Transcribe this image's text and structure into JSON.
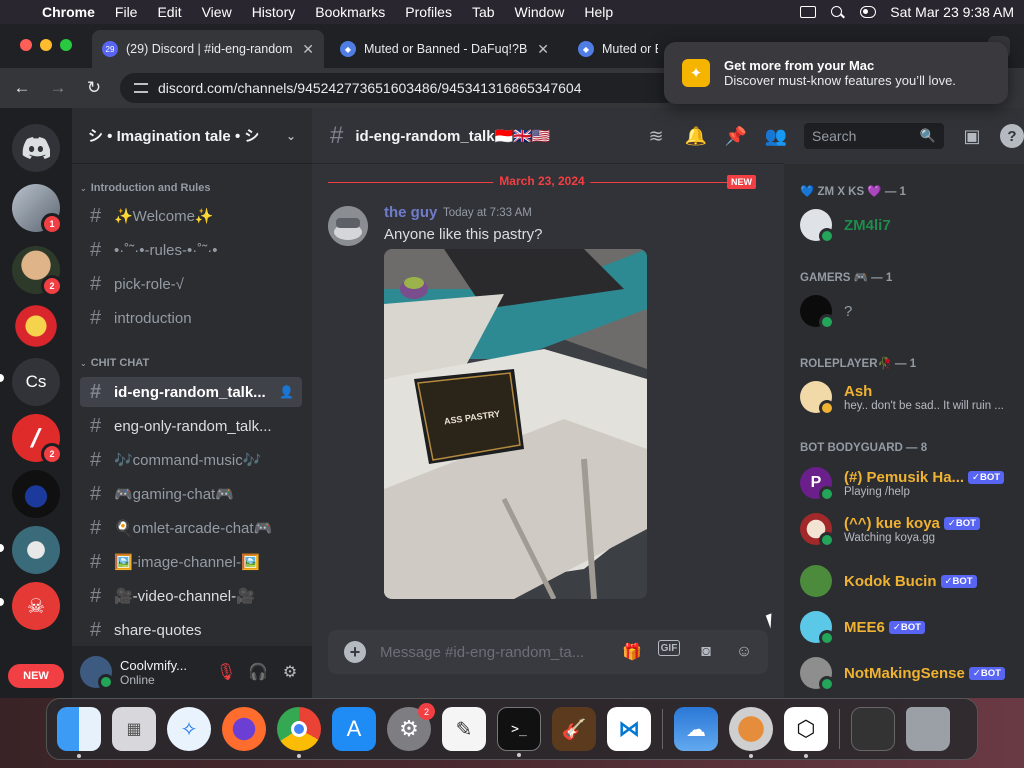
{
  "menubar": {
    "app": "Chrome",
    "items": [
      "File",
      "Edit",
      "View",
      "History",
      "Bookmarks",
      "Profiles",
      "Tab",
      "Window",
      "Help"
    ],
    "clock": "Sat Mar 23  9:38 AM"
  },
  "browser": {
    "tabs": [
      {
        "title": "(29) Discord | #id-eng-random",
        "favicon_badge": "29",
        "active": true
      },
      {
        "title": "Muted or Banned - DaFuq!?B",
        "active": false
      },
      {
        "title": "Muted or Banned - DaFuq!?B",
        "active": false
      }
    ],
    "url": "discord.com/channels/945242773651603486/945341316865347604"
  },
  "notification": {
    "title": "Get more from your Mac",
    "body": "Discover must-know features you’ll love."
  },
  "guilds": {
    "items": [
      {
        "name": "discord-home",
        "badge": null
      },
      {
        "name": "server-1",
        "badge": "1"
      },
      {
        "name": "server-2",
        "badge": "2"
      },
      {
        "name": "server-3",
        "badge": null
      },
      {
        "name": "Cs",
        "label": "Cs",
        "badge": null
      },
      {
        "name": "server-5",
        "badge": "2"
      },
      {
        "name": "server-6",
        "badge": null
      },
      {
        "name": "server-7",
        "badge": null
      },
      {
        "name": "server-8",
        "badge": null
      }
    ],
    "new_label": "NEW"
  },
  "server": {
    "name": "シ • Imagination tale • シ",
    "categories": [
      {
        "name": "Introduction and Rules"
      },
      {
        "name": "CHIT CHAT"
      }
    ],
    "channels": [
      {
        "name": "✨Welcome✨"
      },
      {
        "name": "•·˚˜·•-rules-•·˚˜·•"
      },
      {
        "name": "pick-role-√"
      },
      {
        "name": "introduction"
      },
      {
        "name": "id-eng-random_talk...",
        "active": true
      },
      {
        "name": "eng-only-random_talk..."
      },
      {
        "name": "🎶command-music🎶"
      },
      {
        "name": "🎮gaming-chat🎮"
      },
      {
        "name": "🍳omlet-arcade-chat🎮"
      },
      {
        "name": "🖼️-image-channel-🖼️"
      },
      {
        "name": "🎥-video-channel-🎥"
      },
      {
        "name": "share-quotes"
      }
    ]
  },
  "user": {
    "name": "Coolvmify...",
    "status": "Online"
  },
  "chat": {
    "channel_title": "id-eng-random_talk🇮🇩🇬🇧🇺🇸",
    "search_placeholder": "Search",
    "date_divider": "March 23, 2024",
    "new_tag": "NEW",
    "message": {
      "author": "the guy",
      "time": "Today at 7:33 AM",
      "text": "Anyone like this pastry?",
      "photo_sign": "ASS PASTRY"
    },
    "composer_placeholder": "Message #id-eng-random_ta...",
    "gif_label": "GIF"
  },
  "members": {
    "groups": [
      {
        "title": "💙 ZM X KS 💜 — 1",
        "members": [
          {
            "name": "ZM4li7",
            "color": "#1f8b4c",
            "sub": ""
          }
        ]
      },
      {
        "title": "GAMERS 🎮 — 1",
        "members": [
          {
            "name": "?",
            "color": "#949ba4",
            "sub": ""
          }
        ]
      },
      {
        "title": "ROLEPLAYER🥀 — 1",
        "members": [
          {
            "name": "Ash",
            "color": "#f0b232",
            "sub": "hey.. don't be sad.. It will ruin ..."
          }
        ]
      },
      {
        "title": "BOT BODYGUARD — 8",
        "members": [
          {
            "name": "(#) Pemusik Ha...",
            "color": "#f0b232",
            "sub": "Playing /help",
            "bot": true
          },
          {
            "name": "(^^) kue koya",
            "color": "#f0b232",
            "sub": "Watching koya.gg",
            "bot": true
          },
          {
            "name": "Kodok Bucin",
            "color": "#f0b232",
            "sub": "",
            "bot": true
          },
          {
            "name": "MEE6",
            "color": "#f0b232",
            "sub": "",
            "bot": true
          },
          {
            "name": "NotMakingSense",
            "color": "#f0b232",
            "sub": "",
            "bot": true
          }
        ]
      }
    ],
    "bot_label": "BOT"
  },
  "dock": {
    "apps": [
      "Finder",
      "Launchpad",
      "Safari",
      "Firefox",
      "Chrome",
      "App Store",
      "System Settings",
      "TextEdit",
      "Terminal",
      "GarageBand",
      "VS Code",
      "Weather",
      "Preview",
      "Vector",
      "Screenshot",
      "Trash"
    ],
    "settings_badge": "2"
  }
}
